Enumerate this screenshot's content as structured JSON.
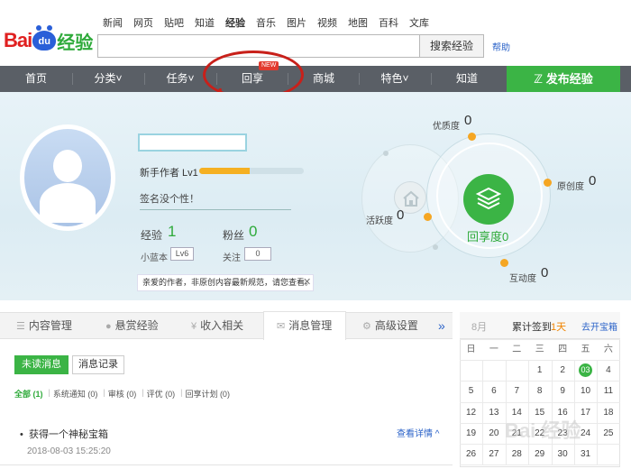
{
  "logo": {
    "bai": "Bai",
    "du": "du",
    "jingyan": "经验"
  },
  "topnav": [
    "新闻",
    "网页",
    "贴吧",
    "知道",
    "经验",
    "音乐",
    "图片",
    "视频",
    "地图",
    "百科",
    "文库"
  ],
  "topnav_active": 4,
  "search": {
    "button": "搜索经验",
    "help": "帮助"
  },
  "nav": [
    "首页",
    "分类˅",
    "任务˅",
    "回享",
    "商城",
    "特色˅",
    "知道"
  ],
  "nav_badge": "NEW",
  "publish": "ℤ 发布经验",
  "profile": {
    "level_label": "新手作者 Lv1",
    "level_progress": 0.48,
    "signature": "签名没个性！",
    "exp_label": "经验",
    "exp_value": "1",
    "fans_label": "粉丝",
    "fans_value": "0",
    "xiaolan_label": "小蓝本",
    "xiaolan_value": "Lv6",
    "follow_label": "关注",
    "follow_value": "0",
    "notice": "亲爱的作者，非原创内容最新规范，请您查看。",
    "notice_close": "✕"
  },
  "radar": {
    "quality_label": "优质度",
    "quality_value": "0",
    "originality_label": "原创度",
    "originality_value": "0",
    "activity_label": "活跃度",
    "activity_value": "0",
    "interaction_label": "互动度",
    "interaction_value": "0",
    "core_label": "回享度",
    "core_value": "0"
  },
  "tabs": [
    {
      "icon": "☰",
      "label": "内容管理"
    },
    {
      "icon": "●",
      "label": "悬赏经验"
    },
    {
      "icon": "¥",
      "label": "收入相关"
    },
    {
      "icon": "✉",
      "label": "消息管理"
    },
    {
      "icon": "⚙",
      "label": "高级设置"
    }
  ],
  "tabs_more": "»",
  "messages": {
    "unread_button": "未读消息",
    "history_button": "消息记录",
    "filters": [
      "全部 (1)",
      "系统通知 (0)",
      "审核 (0)",
      "评优 (0)",
      "回享计划 (0)"
    ],
    "item_title": "获得一个神秘宝箱",
    "item_date": "2018-08-03 15:25:20",
    "item_detail": "查看详情 ^"
  },
  "calendar": {
    "month": "8月",
    "checkin": "累计签到",
    "days": "1天",
    "chest": "去开宝箱",
    "weekdays": [
      "日",
      "一",
      "二",
      "三",
      "四",
      "五",
      "六"
    ],
    "rows": [
      [
        "",
        "",
        "",
        "1",
        "2",
        "03",
        "4"
      ],
      [
        "5",
        "6",
        "7",
        "8",
        "9",
        "10",
        "11"
      ],
      [
        "12",
        "13",
        "14",
        "15",
        "16",
        "17",
        "18"
      ],
      [
        "19",
        "20",
        "21",
        "22",
        "23",
        "24",
        "25"
      ],
      [
        "26",
        "27",
        "28",
        "29",
        "30",
        "31",
        ""
      ]
    ],
    "today": "03"
  },
  "colors": {
    "green": "#3bb445",
    "nav_gray": "#5a5f66",
    "orange": "#f5a623",
    "red_mark": "#c8201a"
  }
}
